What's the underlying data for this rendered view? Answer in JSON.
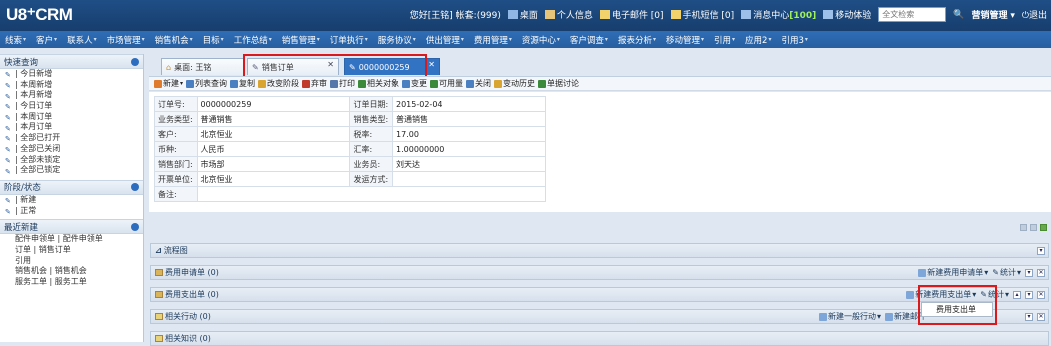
{
  "topbar": {
    "logo": "U8⁺CRM",
    "welcome": "您好[王铭] 帐套:(999)",
    "desktop": "桌面",
    "personal": "个人信息",
    "email": "电子邮件 [0]",
    "sms": "手机短信 [0]",
    "msg_prefix": "消息中心",
    "msg_count": "[100]",
    "mobile": "移动体验",
    "search_placeholder": "全文检索",
    "role": "营销管理",
    "exit": "退出"
  },
  "nav": [
    "线索",
    "客户",
    "联系人",
    "市场管理",
    "销售机会",
    "目标",
    "工作总结",
    "销售管理",
    "订单执行",
    "服务协议",
    "供出管理",
    "费用管理",
    "资源中心",
    "客户调查",
    "报表分析",
    "移动管理",
    "引用",
    "应用2",
    "引用3"
  ],
  "sidebar": {
    "quick_title": "快速查询",
    "quick_items": [
      "| 今日新增",
      "| 本周新增",
      "| 本月新增",
      "| 今日订单",
      "| 本周订单",
      "| 本月订单",
      "| 全部已打开",
      "| 全部已关闭",
      "| 全部未锁定",
      "| 全部已锁定"
    ],
    "stage_title": "阶段/状态",
    "stage_items": [
      "| 新建",
      "| 正常"
    ],
    "recent_title": "最近新建",
    "recent_items": [
      "配件申领单 | 配件申领单",
      "订单 | 销售订单",
      "引用",
      "销售机会 | 销售机会",
      "服务工单 | 服务工单"
    ]
  },
  "tabs": {
    "t1": "桌面: 王铭",
    "t2": "销售订单",
    "t3": "0000000259"
  },
  "toolbar": [
    "新建",
    "列表查询",
    "复制",
    "改变阶段",
    "弃审",
    "打印",
    "相关对象",
    "变更",
    "可用量",
    "关闭",
    "变动历史",
    "单据讨论"
  ],
  "form": {
    "order_no_label": "订单号:",
    "order_no": "0000000259",
    "order_date_label": "订单日期:",
    "order_date": "2015-02-04",
    "biz_type_label": "业务类型:",
    "biz_type": "普通销售",
    "sale_type_label": "销售类型:",
    "sale_type": "普通销售",
    "customer_label": "客户:",
    "customer": "北京恒业",
    "tax_label": "税率:",
    "tax": "17.00",
    "currency_label": "币种:",
    "currency": "人民币",
    "rate_label": "汇率:",
    "rate": "1.00000000",
    "dept_label": "销售部门:",
    "dept": "市场部",
    "staff_label": "业务员:",
    "staff": "刘天达",
    "invoice_label": "开票单位:",
    "invoice": "北京恒业",
    "ship_label": "发运方式:",
    "ship": "",
    "note_label": "备注:",
    "note": ""
  },
  "panels": {
    "flow": "流程图",
    "fee_apply": "费用申请单 (0)",
    "fee_apply_new": "新建费用申请单",
    "stats": "统计",
    "fee_spend": "费用支出单 (0)",
    "fee_spend_new": "新建费用支出单",
    "actions": "相关行动 (0)",
    "new_action": "新建一般行动",
    "new_mail": "新建邮件",
    "knowledge": "相关知识 (0)"
  },
  "dropdown_option": "费用支出单"
}
